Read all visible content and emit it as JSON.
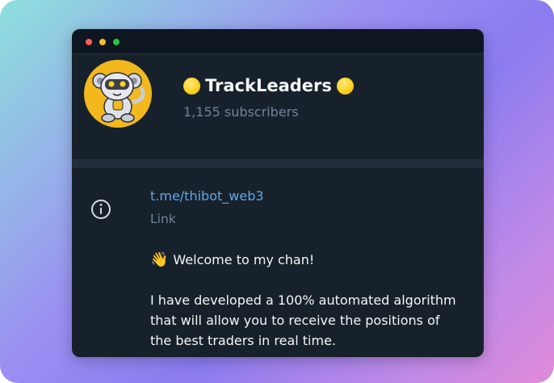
{
  "channel": {
    "title": "TrackLeaders",
    "subscribers": "1,155 subscribers"
  },
  "info": {
    "link": "t.me/thibot_web3",
    "link_label": "Link",
    "description": {
      "greeting_emoji": "👋",
      "greeting": "Welcome to my chan!",
      "lines": [
        "I have developed a 100% automated algorithm",
        "that will allow you to receive the positions of",
        "the best traders in real time."
      ]
    }
  },
  "colors": {
    "background": "#17212b",
    "titlebar": "#0e1621",
    "link": "#5ea8e6",
    "muted": "#708499",
    "avatar_bg": "#f2b81e"
  }
}
